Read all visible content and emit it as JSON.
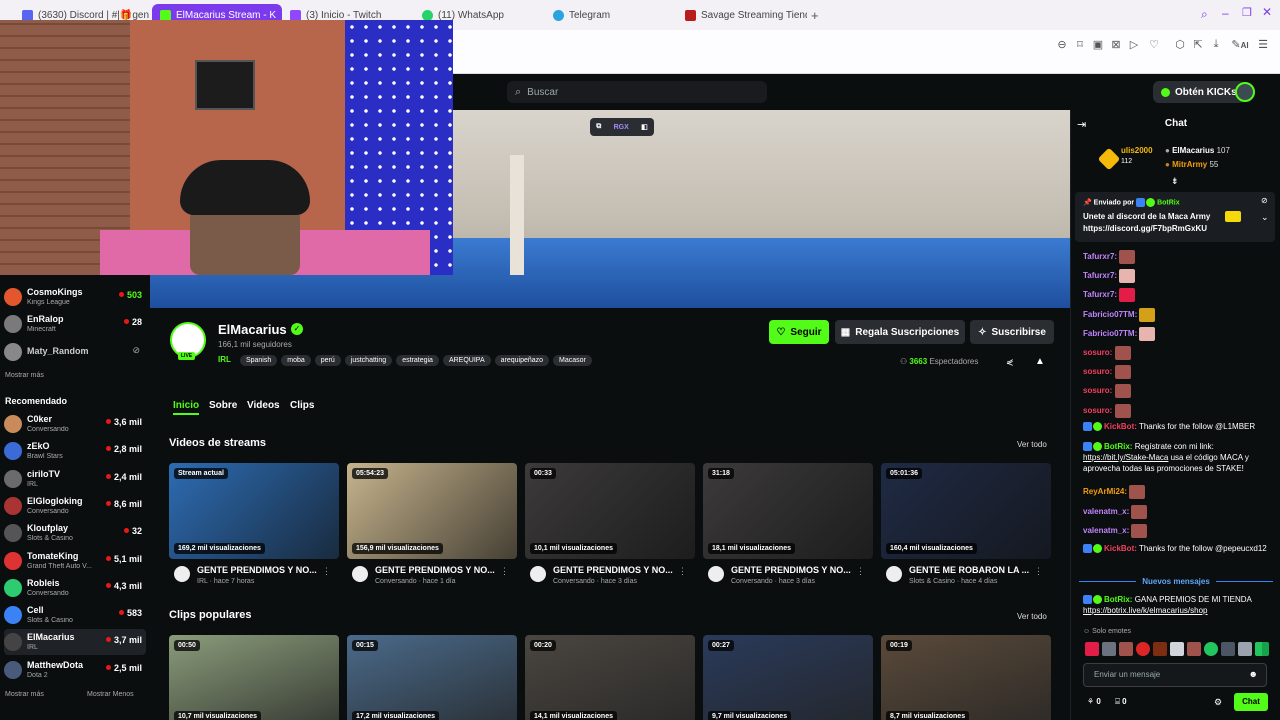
{
  "browser": {
    "tabs": [
      {
        "label": "(3630) Discord | #|🎁gen",
        "color": "#5865f2"
      },
      {
        "label": "ElMacarius Stream - K",
        "color": "#53fc18",
        "active": true
      },
      {
        "label": "(3) Inicio - Twitch",
        "color": "#9146ff"
      },
      {
        "label": "(11) WhatsApp",
        "color": "#25d366"
      },
      {
        "label": "Telegram",
        "color": "#2aa3e0"
      },
      {
        "label": "Savage Streaming Tienda",
        "color": "#b91c1c"
      }
    ],
    "new_tab": "+",
    "ai_label": "AI"
  },
  "header": {
    "search_placeholder": "Buscar",
    "kicks_label": "Obtén KICKs"
  },
  "video_overlay": {
    "rgx_label": "RGX"
  },
  "sidebar": {
    "following": [
      {
        "name": "CosmoKings",
        "category": "Kings League",
        "viewers": "503",
        "color": "#e4572e"
      },
      {
        "name": "EnRalop",
        "category": "Minecraft",
        "viewers": "28",
        "color": "#7a7a7a"
      },
      {
        "name": "Maty_Random",
        "category": "",
        "viewers": "",
        "color": "#888"
      }
    ],
    "show_more": "Mostrar más",
    "recommended_title": "Recomendado",
    "recommended": [
      {
        "name": "C0ker",
        "category": "Conversando",
        "viewers": "3,6 mil",
        "color": "#c98a5c"
      },
      {
        "name": "zEkO",
        "category": "Brawl Stars",
        "viewers": "2,8 mil",
        "color": "#3b6bd6"
      },
      {
        "name": "ciriloTV",
        "category": "IRL",
        "viewers": "2,4 mil",
        "color": "#6b6b6b"
      },
      {
        "name": "ElGlogloking",
        "category": "Conversando",
        "viewers": "8,6 mil",
        "color": "#a33"
      },
      {
        "name": "Kloufplay",
        "category": "Slots & Casino",
        "viewers": "32",
        "color": "#555"
      },
      {
        "name": "TomateKing",
        "category": "Grand Theft Auto V...",
        "viewers": "5,1 mil",
        "color": "#d33"
      },
      {
        "name": "Robleis",
        "category": "Conversando",
        "viewers": "4,3 mil",
        "color": "#2ecc71"
      },
      {
        "name": "Cell",
        "category": "Slots & Casino",
        "viewers": "583",
        "color": "#3b82f6"
      },
      {
        "name": "ElMacarius",
        "category": "IRL",
        "viewers": "3,7 mil",
        "color": "#444"
      },
      {
        "name": "MatthewDota",
        "category": "Dota 2",
        "viewers": "2,5 mil",
        "color": "#4a5a7a"
      }
    ],
    "show_more_bottom": "Mostrar más",
    "show_less": "Mostrar Menos"
  },
  "channel": {
    "name": "ElMacarius",
    "followers": "166,1 mil seguidores",
    "live_badge": "LIVE",
    "category": "IRL",
    "tags": [
      "Spanish",
      "moba",
      "perú",
      "justchatting",
      "estrategia",
      "AREQUIPA",
      "arequipeñazo",
      "Macasor"
    ],
    "follow_label": "Seguir",
    "gift_label": "Regala Suscripciones",
    "subscribe_label": "Suscribirse",
    "viewers_count": "3663",
    "viewers_label": "Espectadores",
    "tabs": [
      "Inicio",
      "Sobre",
      "Videos",
      "Clips"
    ]
  },
  "streams_section": {
    "title": "Videos de streams",
    "see_all": "Ver todo",
    "items": [
      {
        "badge": "Stream actual",
        "views": "169,2 mil visualizaciones",
        "title": "GENTE PRENDIMOS Y NO...",
        "meta": "IRL · hace 7 horas",
        "color": "#2d6cb3"
      },
      {
        "badge": "05:54:23",
        "views": "156,9 mil visualizaciones",
        "title": "GENTE PRENDIMOS Y NO...",
        "meta": "Conversando · hace 1 día",
        "color": "#c7b48d"
      },
      {
        "badge": "00:33",
        "views": "10,1 mil visualizaciones",
        "title": "GENTE PRENDIMOS Y NO...",
        "meta": "Conversando · hace 3 días",
        "color": "#3c3a3a"
      },
      {
        "badge": "31:18",
        "views": "18,1 mil visualizaciones",
        "title": "GENTE PRENDIMOS Y NO...",
        "meta": "Conversando · hace 3 días",
        "color": "#3c3a3a"
      },
      {
        "badge": "05:01:36",
        "views": "160,4 mil visualizaciones",
        "title": "GENTE ME ROBARON LA ...",
        "meta": "Slots & Casino · hace 4 días",
        "color": "#1f2a44"
      }
    ]
  },
  "clips_section": {
    "title": "Clips populares",
    "see_all": "Ver todo",
    "items": [
      {
        "badge": "00:50",
        "views": "10,7 mil visualizaciones",
        "color": "#8a9c7a"
      },
      {
        "badge": "00:15",
        "views": "17,2 mil visualizaciones",
        "color": "#4a6a8a"
      },
      {
        "badge": "00:20",
        "views": "14,1 mil visualizaciones",
        "color": "#4a4640"
      },
      {
        "badge": "00:27",
        "views": "9,7 mil visualizaciones",
        "color": "#2a3a5a"
      },
      {
        "badge": "00:19",
        "views": "8,7 mil visualizaciones",
        "color": "#5a4a3a"
      }
    ]
  },
  "chat": {
    "title": "Chat",
    "leaders": [
      {
        "name": "ulis2000",
        "value": "112"
      },
      {
        "name": "ElMacarius",
        "value": "107"
      },
      {
        "name": "MitrArmy",
        "value": "55"
      }
    ],
    "pinned": {
      "sent_by": "Enviado por",
      "author": "BotRix",
      "text": "Unete al discord de la Maca Army",
      "link": "https://discord.gg/F7bpRmGxKU"
    },
    "messages": [
      {
        "user": "Tafurxr7:",
        "text": "",
        "color": "#c084fc",
        "emote": "#a0524d"
      },
      {
        "user": "Tafurxr7:",
        "text": "",
        "color": "#c084fc",
        "emote": "#e8b4b0"
      },
      {
        "user": "Tafurxr7:",
        "text": "",
        "color": "#c084fc",
        "emote": "#e11d48"
      },
      {
        "user": "Fabricio07TM:",
        "text": "",
        "color": "#c084fc",
        "emote": "#d4a017"
      },
      {
        "user": "Fabricio07TM:",
        "text": "",
        "color": "#c084fc",
        "emote": "#e8b4b0"
      },
      {
        "user": "sosuro:",
        "text": "",
        "color": "#f43f5e",
        "emote": "#a0524d"
      },
      {
        "user": "sosuro:",
        "text": "",
        "color": "#f43f5e",
        "emote": "#a0524d"
      },
      {
        "user": "sosuro:",
        "text": "",
        "color": "#f43f5e",
        "emote": "#a0524d"
      },
      {
        "user": "sosuro:",
        "text": "",
        "color": "#f43f5e",
        "emote": "#a0524d"
      }
    ],
    "kickbot1": {
      "user": "KickBot:",
      "text": "Thanks for the follow @L1MBER"
    },
    "botrix1": {
      "user": "BotRix:",
      "text": "Regístrate con mi link:",
      "link": "https://bit.ly/Stake-Maca",
      "text2": "usa el código MACA y aprovecha todas las promociones de STAKE!"
    },
    "reyar": {
      "user": "ReyArMi24:"
    },
    "valenatm1": {
      "user": "valenatm_x:"
    },
    "valenatm2": {
      "user": "valenatm_x:"
    },
    "kickbot2": {
      "user": "KickBot:",
      "text": "Thanks for the follow @pepeucxd12"
    },
    "new_messages": "Nuevos mensajes",
    "botrix2": {
      "user": "BotRix:",
      "text": "GANA PREMIOS DE MI TIENDA",
      "link": "https://botrix.live/k/elmacarius/shop"
    },
    "emote_only": "Solo emotes",
    "input_placeholder": "Enviar un mensaje",
    "points1": "0",
    "points2": "0",
    "send_label": "Chat"
  }
}
